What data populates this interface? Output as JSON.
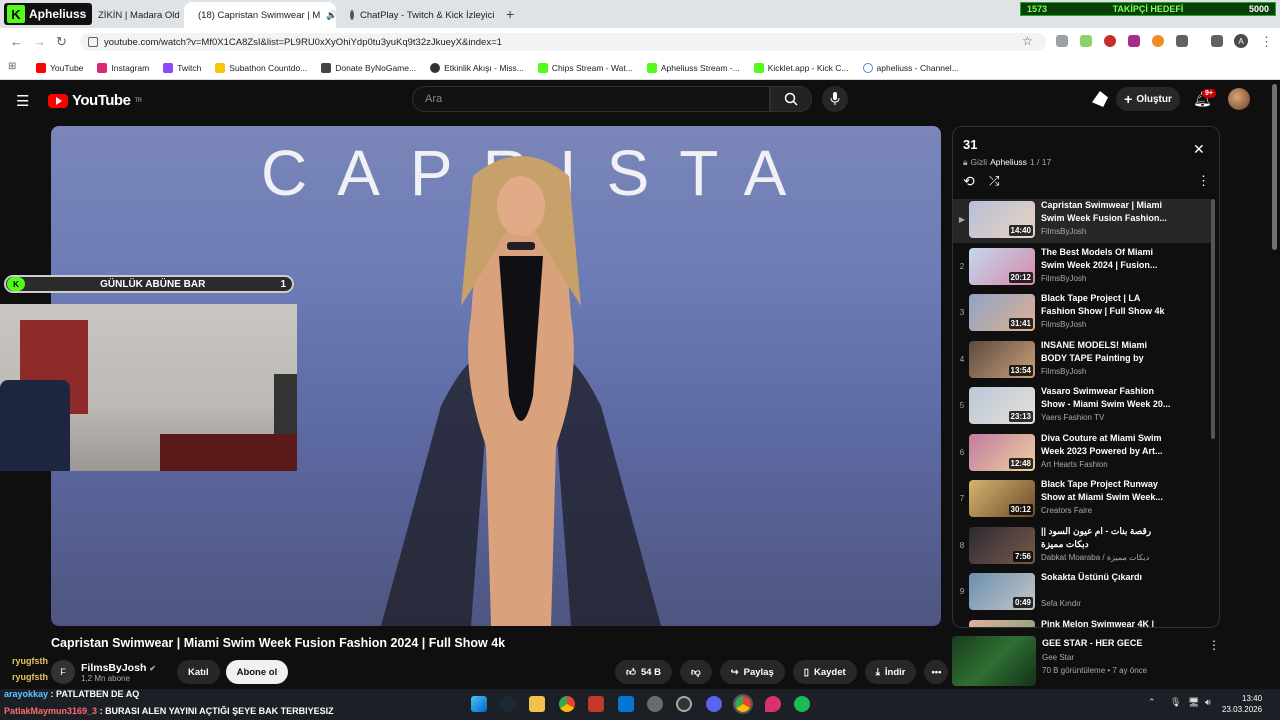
{
  "kick": {
    "name": "Apheliuss",
    "follow_current": "1573",
    "follow_label": "TAKİPÇİ HEDEFİ",
    "follow_target": "5000"
  },
  "tabs": [
    {
      "label": "ZİKİN | Madara Old"
    },
    {
      "label": "(18) Capristan Swimwear | M"
    },
    {
      "label": "ChatPlay - Twitch & Kick İzleyici"
    }
  ],
  "url": "youtube.com/watch?v=Mf0X1CA8ZsI&list=PL9RU0xXyOhiYdp0tu3yuKq9t32zJkueyX&index=1",
  "bookmarks": [
    "YouTube",
    "Instagram",
    "Twitch",
    "Subathon Countdo...",
    "Donate ByNoGame...",
    "Etkinlik Akışı - Miss...",
    "Chips Stream - Wat...",
    "Apheliuss Stream -...",
    "Kicklet.app - Kick C...",
    "apheliuss - Channel..."
  ],
  "youtube": {
    "logo": "YouTube",
    "region": "TR",
    "search_placeholder": "Ara",
    "create_label": "Oluştur",
    "notif_count": "9+"
  },
  "video": {
    "brand": "CAPRISTA",
    "title": "Capristan Swimwear | Miami Swim Week Fusion Fashion 2024 | Full Show 4k"
  },
  "channel": {
    "name": "FilmsByJosh",
    "subs": "1,2 Mn abone",
    "join": "Katıl",
    "subscribe": "Abone ol"
  },
  "actions": {
    "likes": "54 B",
    "share": "Paylaş",
    "save": "Kaydet",
    "download": "İndir"
  },
  "subbar": {
    "label": "GÜNLÜK ABÜNE BAR",
    "count": "1"
  },
  "playlist": {
    "name": "31",
    "privacy": "Gizli",
    "owner": "Apheliuss",
    "position": "1 / 17",
    "items": [
      {
        "num": "▶",
        "title": "Capristan Swimwear | Miami Swim Week Fusion Fashion...",
        "channel": "FilmsByJosh",
        "dur": "14:40"
      },
      {
        "num": "2",
        "title": "The Best Models Of Miami Swim Week 2024 | Fusion...",
        "channel": "FilmsByJosh",
        "dur": "20:12"
      },
      {
        "num": "3",
        "title": "Black Tape Project | LA Fashion Show | Full Show 4k",
        "channel": "FilmsByJosh",
        "dur": "31:41"
      },
      {
        "num": "4",
        "title": "INSANE MODELS! Miami BODY TAPE Painting by Farnello |...",
        "channel": "FilmsByJosh",
        "dur": "13:54"
      },
      {
        "num": "5",
        "title": "Vasaro Swimwear Fashion Show - Miami Swim Week 20...",
        "channel": "Yaers Fashion TV",
        "dur": "23:13"
      },
      {
        "num": "6",
        "title": "Diva Couture at Miami Swim Week 2023 Powered by Art...",
        "channel": "Art Hearts Fashion",
        "dur": "12:48"
      },
      {
        "num": "7",
        "title": "Black Tape Project Runway Show at Miami Swim Week...",
        "channel": "Creators Faire",
        "dur": "30:12"
      },
      {
        "num": "8",
        "title": "رقصة بنات - ام عيون السود || دبكات مميزة",
        "channel": "Dabkat Moaraba / دبكات مميزة",
        "dur": "7:56"
      },
      {
        "num": "9",
        "title": "Sokakta Üstünü Çıkardı",
        "channel": "Sefa Kındır",
        "dur": "0:49"
      },
      {
        "num": "",
        "title": "Pink Melon Swimwear 4K |",
        "channel": "",
        "dur": ""
      }
    ]
  },
  "recommended": {
    "title": "GEE STAR - HER GECE",
    "channel": "Gee Star",
    "meta": "70 B görüntüleme • 7 ay önce"
  },
  "chat": [
    {
      "user": "ryugfsth",
      "msg": ""
    },
    {
      "user": "ryugfsth",
      "msg": ""
    },
    {
      "user": "arayokkay",
      "msg": "PATLATBEN DE AQ"
    },
    {
      "user": "PatlakMaymun3169_3",
      "msg": "BURASI ALEN YAYINI AÇTIĞI ŞEYE BAK TERBIYESIZ"
    }
  ],
  "clock": {
    "time": "13:40",
    "date": "23.03.2026"
  }
}
